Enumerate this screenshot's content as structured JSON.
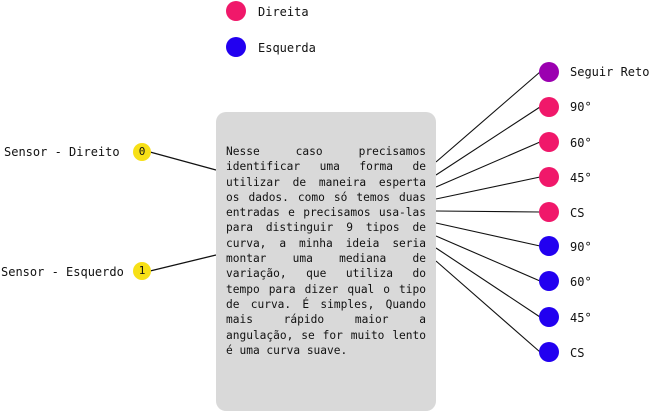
{
  "legend": [
    {
      "label": "Direita",
      "color": "#f0186a"
    },
    {
      "label": "Esquerda",
      "color": "#2200f0"
    }
  ],
  "sensors": [
    {
      "label": "Sensor - Direito",
      "badge": "0"
    },
    {
      "label": "Sensor - Esquerdo",
      "badge": "1"
    }
  ],
  "description": "Nesse caso precisamos identificar uma forma de utilizar de maneira esperta os dados. como só temos duas entradas e precisamos usa-las para distinguir 9 tipos de curva, a minha ideia seria montar uma mediana de variação, que utiliza do tempo para dizer qual o tipo de curva. É simples, Quando mais rápido maior a angulação, se for muito lento é uma curva suave.",
  "outputs": [
    {
      "label": "Seguir Reto",
      "color": "#9b00b0"
    },
    {
      "label": "90°",
      "color": "#f0186a"
    },
    {
      "label": "60°",
      "color": "#f0186a"
    },
    {
      "label": "45°",
      "color": "#f0186a"
    },
    {
      "label": "CS",
      "color": "#f0186a"
    },
    {
      "label": "90°",
      "color": "#2200f0"
    },
    {
      "label": "60°",
      "color": "#2200f0"
    },
    {
      "label": "45°",
      "color": "#2200f0"
    },
    {
      "label": "CS",
      "color": "#2200f0"
    }
  ],
  "badge_color": "#f7e017",
  "box_color": "#d9d9d9"
}
